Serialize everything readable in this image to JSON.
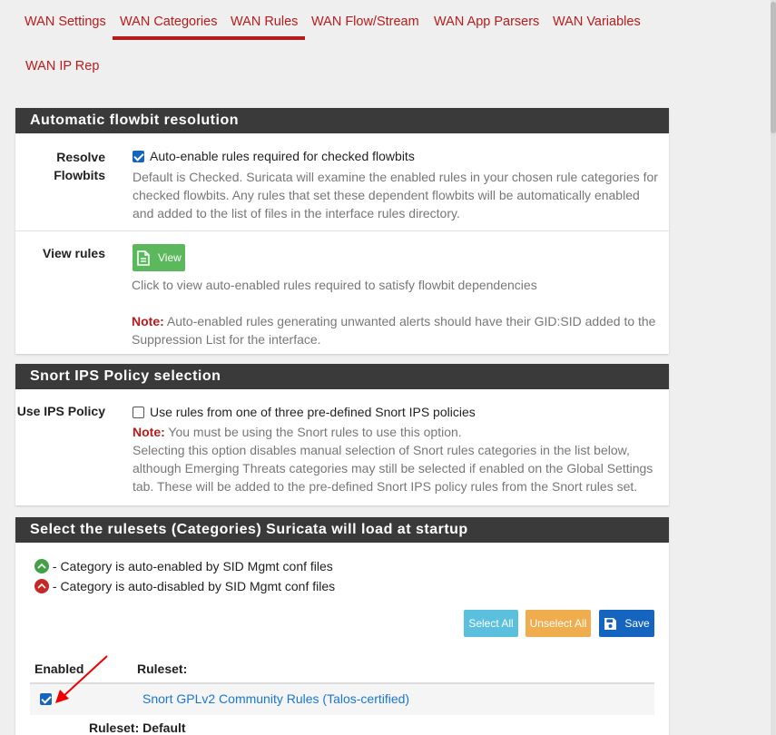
{
  "tabs": [
    {
      "label": "WAN Settings",
      "active": false
    },
    {
      "label": "WAN Categories",
      "active": true
    },
    {
      "label": "WAN Rules",
      "active": true
    },
    {
      "label": "WAN Flow/Stream",
      "active": false
    },
    {
      "label": "WAN App Parsers",
      "active": false
    },
    {
      "label": "WAN Variables",
      "active": false
    },
    {
      "label": "WAN IP Rep",
      "active": false
    }
  ],
  "flowbit": {
    "title": "Automatic flowbit resolution",
    "resolve_label_1": "Resolve",
    "resolve_label_2": "Flowbits",
    "resolve_checkbox_label": "Auto-enable rules required for checked flowbits",
    "resolve_checked": true,
    "resolve_help_1": "Default is Checked. Suricata will examine the enabled rules in your chosen rule categories for",
    "resolve_help_2": "checked flowbits. Any rules that set these dependent flowbits will be automatically enabled",
    "resolve_help_3": "and added to the list of files in the interface rules directory.",
    "view_label": "View rules",
    "view_button": "View",
    "view_help": "Click to view auto-enabled rules required to satisfy flowbit dependencies",
    "note_prefix": "Note:",
    "view_note_1": " Auto-enabled rules generating unwanted alerts should have their GID:SID added to the",
    "view_note_2": "Suppression List for the interface."
  },
  "ips": {
    "title": "Snort IPS Policy selection",
    "label": "Use IPS Policy",
    "checkbox_label": "Use rules from one of three pre-defined Snort IPS policies",
    "checked": false,
    "note_prefix": "Note:",
    "note_text": " You must be using the Snort rules to use this option.",
    "help_1": "Selecting this option disables manual selection of Snort rules categories in the list below,",
    "help_2": "although Emerging Threats categories may still be selected if enabled on the Global Settings",
    "help_3": "tab. These will be added to the pre-defined Snort IPS policy rules from the Snort rules set."
  },
  "rulesets": {
    "title": "Select the rulesets (Categories) Suricata will load at startup",
    "legend_enabled": " - Category is auto-enabled by SID Mgmt conf files",
    "legend_disabled": " - Category is auto-disabled by SID Mgmt conf files",
    "select_all": "Select All",
    "unselect_all": "Unselect All",
    "save": "Save",
    "col_enabled": "Enabled",
    "col_ruleset": "Ruleset:",
    "rows": [
      {
        "name": "Snort GPLv2 Community Rules (Talos-certified)",
        "checked": true
      }
    ],
    "default_label": "Ruleset: Default"
  },
  "colors": {
    "accent": "#b71c1c",
    "header_bg": "#3a3a3a",
    "view_btn": "#5cb85c",
    "select_all_btn": "#5bc0de",
    "unselect_all_btn": "#f0ad4e",
    "save_btn": "#1565c0",
    "link": "#1976d2"
  }
}
